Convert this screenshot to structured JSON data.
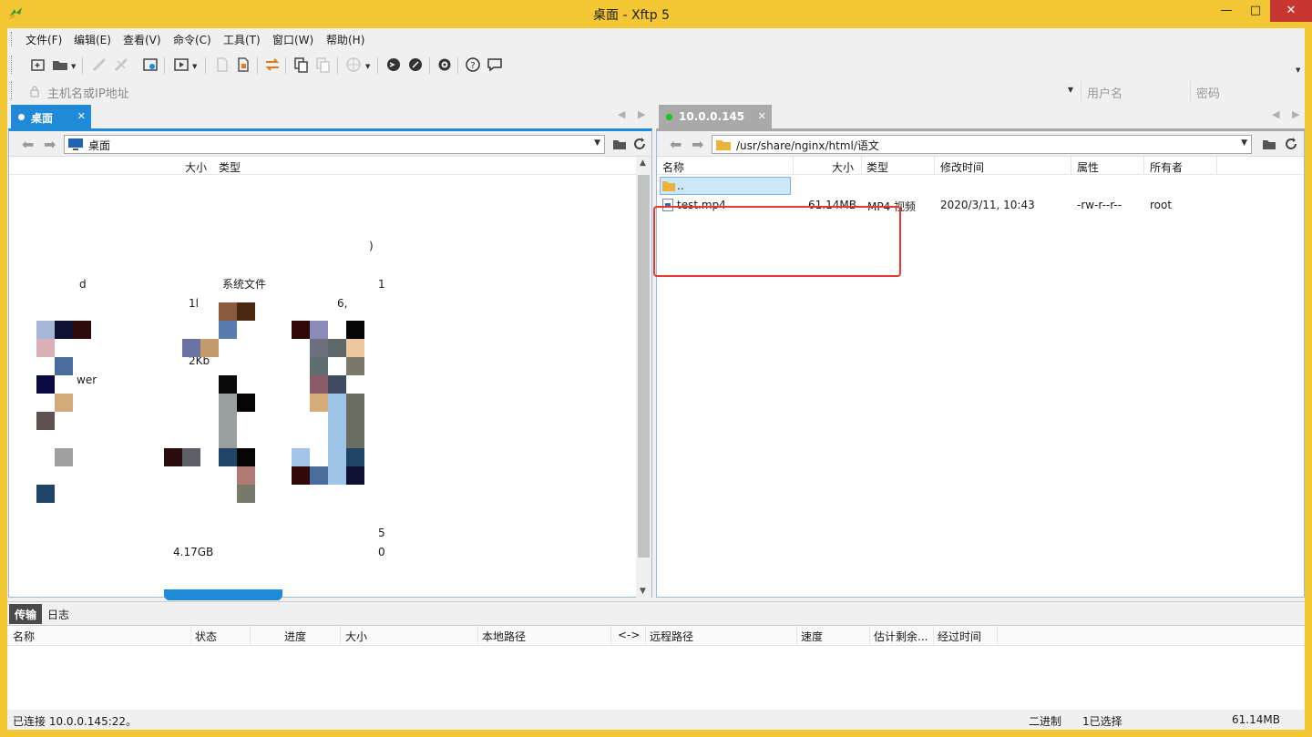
{
  "window": {
    "title": "桌面 - Xftp 5",
    "minimize_glyph": "—",
    "maximize_glyph": "□",
    "close_glyph": "✕"
  },
  "menu": [
    "文件(F)",
    "编辑(E)",
    "查看(V)",
    "命令(C)",
    "工具(T)",
    "窗口(W)",
    "帮助(H)"
  ],
  "toolbar": {
    "icons": [
      "new-session-icon",
      "open-folder-icon",
      "connect-icon",
      "disconnect-icon",
      "session-properties-icon",
      "play-icon",
      "new-file-icon",
      "edit-file-icon",
      "sync-icon",
      "copy-icon",
      "paste-icon",
      "globe-icon",
      "xshell-icon",
      "xshell-alt-icon",
      "settings-icon",
      "help-icon",
      "feedback-icon"
    ]
  },
  "address": {
    "host_placeholder": "主机名或IP地址",
    "user_placeholder": "用户名",
    "password_placeholder": "密码"
  },
  "local": {
    "tab_label": "桌面",
    "path": "桌面",
    "columns": {
      "size": "大小",
      "type": "类型"
    },
    "visible_fragments": [
      ")",
      "d",
      "系统文件",
      "1",
      "1l",
      "6,",
      "2Kb",
      "wer",
      "5",
      "4.17GB",
      "0"
    ]
  },
  "remote": {
    "tab_label": "10.0.0.145",
    "path": "/usr/share/nginx/html/语文",
    "columns": {
      "name": "名称",
      "size": "大小",
      "type": "类型",
      "modified": "修改时间",
      "attributes": "属性",
      "owner": "所有者"
    },
    "rows": [
      {
        "name": "..",
        "size": "",
        "type": "",
        "modified": "",
        "attributes": "",
        "owner": ""
      },
      {
        "name": "test.mp4",
        "size": "61.14MB",
        "type": "MP4 视频",
        "modified": "2020/3/11, 10:43",
        "attributes": "-rw-r--r--",
        "owner": "root"
      }
    ]
  },
  "transfer": {
    "tabs": [
      "传输",
      "日志"
    ],
    "columns": [
      "名称",
      "状态",
      "进度",
      "大小",
      "本地路径",
      "<->",
      "远程路径",
      "速度",
      "估计剩余...",
      "经过时间"
    ]
  },
  "status": {
    "connection": "已连接 10.0.0.145:22。",
    "mode": "二进制",
    "selected": "1已选择",
    "size": "61.14MB"
  },
  "colors": {
    "title_bg": "#f3c634",
    "local_accent": "#1e8ad8",
    "highlight": "#e53935",
    "online": "#17c317"
  }
}
